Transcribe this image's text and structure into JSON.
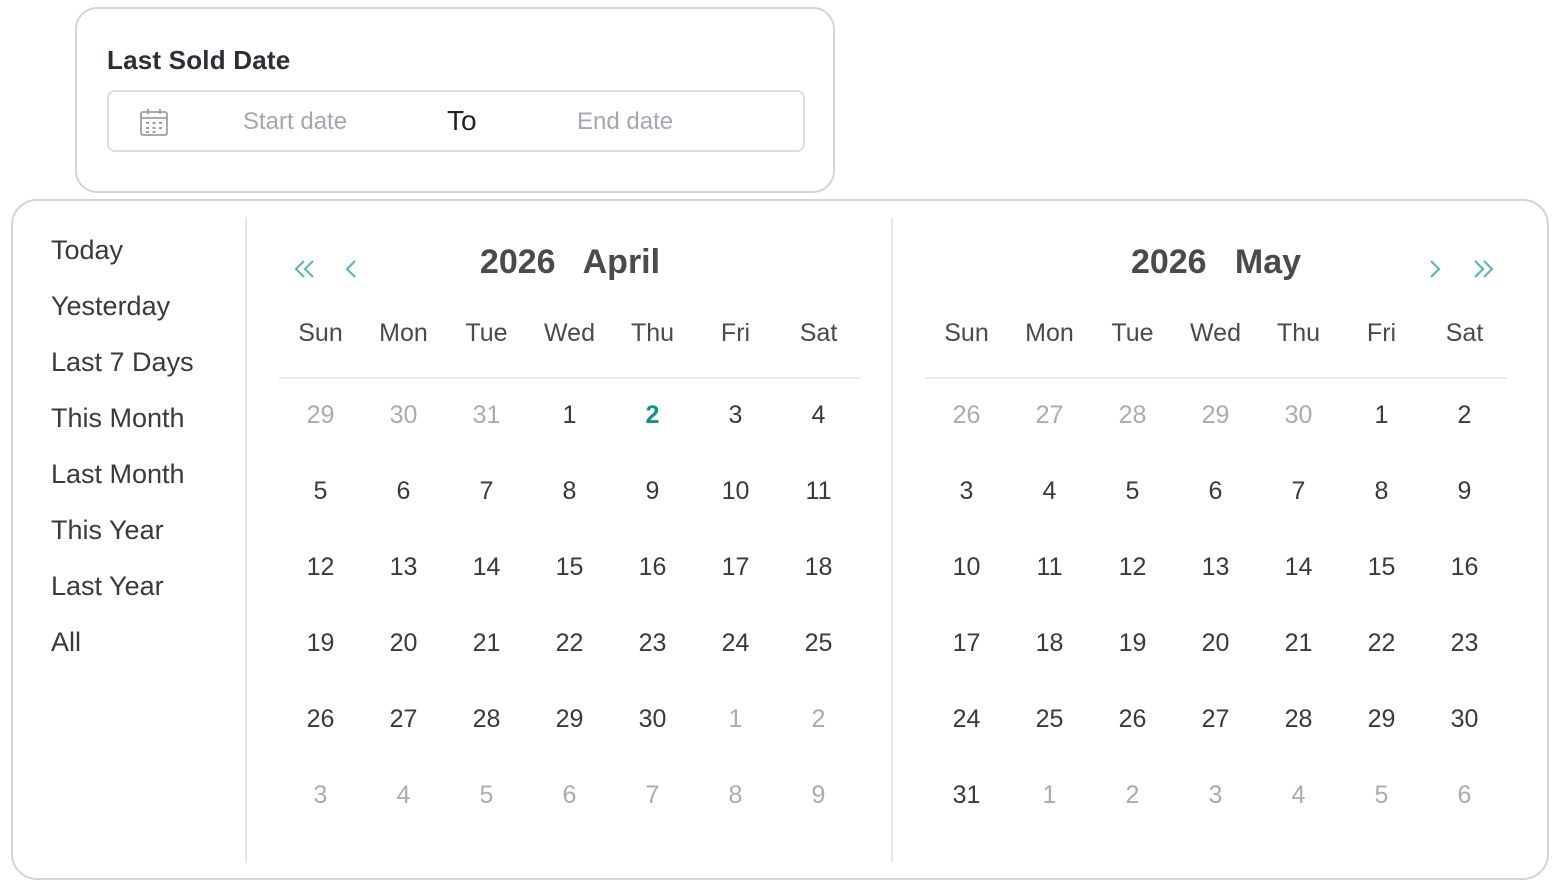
{
  "field": {
    "label": "Last Sold Date",
    "start_placeholder": "Start date",
    "separator": "To",
    "end_placeholder": "End date"
  },
  "presets": [
    "Today",
    "Yesterday",
    "Last 7 Days",
    "This Month",
    "Last Month",
    "This Year",
    "Last Year",
    "All"
  ],
  "weekdays": [
    "Sun",
    "Mon",
    "Tue",
    "Wed",
    "Thu",
    "Fri",
    "Sat"
  ],
  "colors": {
    "accent": "#13908a",
    "muted_day": "#a9abb0",
    "border": "#d4d4d4"
  },
  "calendars": [
    {
      "title": "2026   April",
      "weeks": [
        [
          {
            "d": "29",
            "m": true
          },
          {
            "d": "30",
            "m": true
          },
          {
            "d": "31",
            "m": true
          },
          {
            "d": "1"
          },
          {
            "d": "2",
            "today": true
          },
          {
            "d": "3"
          },
          {
            "d": "4"
          }
        ],
        [
          {
            "d": "5"
          },
          {
            "d": "6"
          },
          {
            "d": "7"
          },
          {
            "d": "8"
          },
          {
            "d": "9"
          },
          {
            "d": "10"
          },
          {
            "d": "11"
          }
        ],
        [
          {
            "d": "12"
          },
          {
            "d": "13"
          },
          {
            "d": "14"
          },
          {
            "d": "15"
          },
          {
            "d": "16"
          },
          {
            "d": "17"
          },
          {
            "d": "18"
          }
        ],
        [
          {
            "d": "19"
          },
          {
            "d": "20"
          },
          {
            "d": "21"
          },
          {
            "d": "22"
          },
          {
            "d": "23"
          },
          {
            "d": "24"
          },
          {
            "d": "25"
          }
        ],
        [
          {
            "d": "26"
          },
          {
            "d": "27"
          },
          {
            "d": "28"
          },
          {
            "d": "29"
          },
          {
            "d": "30"
          },
          {
            "d": "1",
            "m": true
          },
          {
            "d": "2",
            "m": true
          }
        ],
        [
          {
            "d": "3",
            "m": true
          },
          {
            "d": "4",
            "m": true
          },
          {
            "d": "5",
            "m": true
          },
          {
            "d": "6",
            "m": true
          },
          {
            "d": "7",
            "m": true
          },
          {
            "d": "8",
            "m": true
          },
          {
            "d": "9",
            "m": true
          }
        ]
      ]
    },
    {
      "title": "2026   May",
      "weeks": [
        [
          {
            "d": "26",
            "m": true
          },
          {
            "d": "27",
            "m": true
          },
          {
            "d": "28",
            "m": true
          },
          {
            "d": "29",
            "m": true
          },
          {
            "d": "30",
            "m": true
          },
          {
            "d": "1"
          },
          {
            "d": "2"
          }
        ],
        [
          {
            "d": "3"
          },
          {
            "d": "4"
          },
          {
            "d": "5"
          },
          {
            "d": "6"
          },
          {
            "d": "7"
          },
          {
            "d": "8"
          },
          {
            "d": "9"
          }
        ],
        [
          {
            "d": "10"
          },
          {
            "d": "11"
          },
          {
            "d": "12"
          },
          {
            "d": "13"
          },
          {
            "d": "14"
          },
          {
            "d": "15"
          },
          {
            "d": "16"
          }
        ],
        [
          {
            "d": "17"
          },
          {
            "d": "18"
          },
          {
            "d": "19"
          },
          {
            "d": "20"
          },
          {
            "d": "21"
          },
          {
            "d": "22"
          },
          {
            "d": "23"
          }
        ],
        [
          {
            "d": "24"
          },
          {
            "d": "25"
          },
          {
            "d": "26"
          },
          {
            "d": "27"
          },
          {
            "d": "28"
          },
          {
            "d": "29"
          },
          {
            "d": "30"
          }
        ],
        [
          {
            "d": "31"
          },
          {
            "d": "1",
            "m": true
          },
          {
            "d": "2",
            "m": true
          },
          {
            "d": "3",
            "m": true
          },
          {
            "d": "4",
            "m": true
          },
          {
            "d": "5",
            "m": true
          },
          {
            "d": "6",
            "m": true
          }
        ]
      ]
    }
  ]
}
